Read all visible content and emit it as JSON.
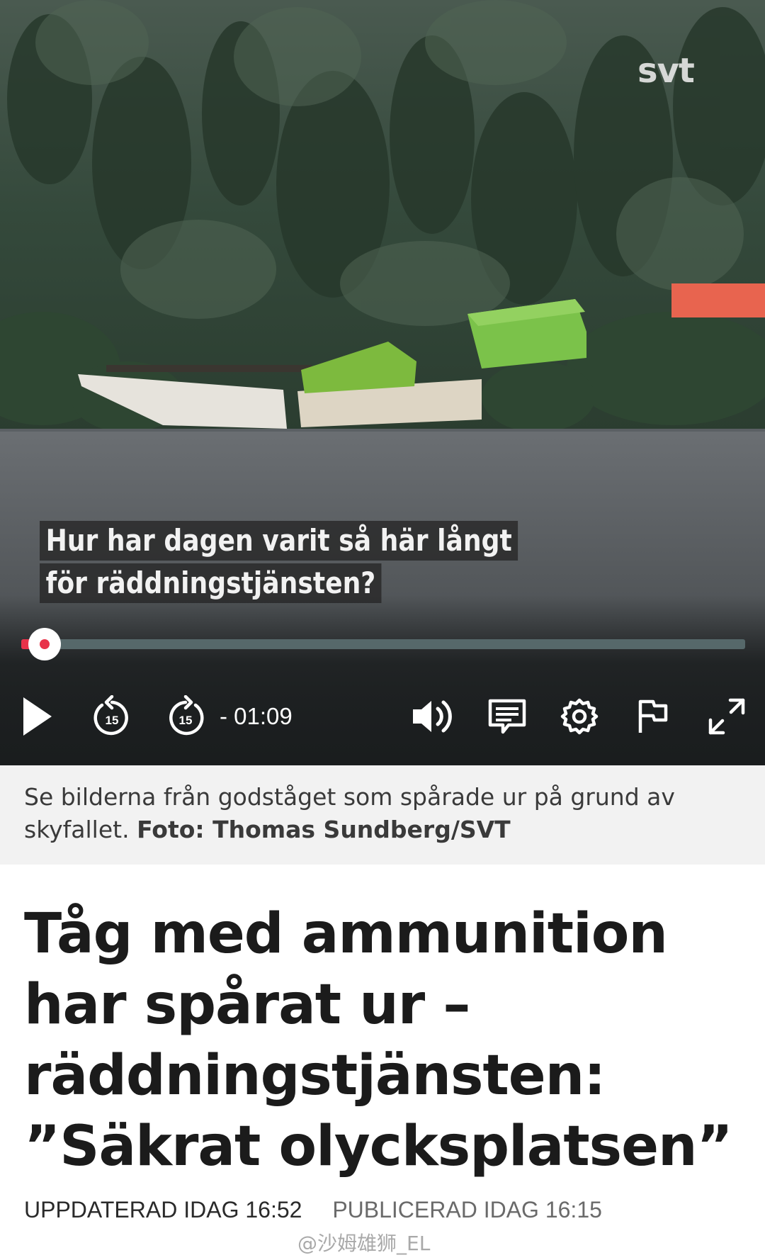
{
  "video": {
    "brand_logo": "svt",
    "subtitle_lines": [
      "Hur har dagen varit så här långt",
      "för räddningstjänsten?"
    ],
    "progress_fraction": 0.01,
    "time_remaining": "- 01:09",
    "skip_back_seconds": "15",
    "skip_forward_seconds": "15",
    "accent_color": "#e8334a",
    "controls": {
      "play": "play-icon",
      "rewind": "rewind-15-icon",
      "forward": "forward-15-icon",
      "volume": "volume-icon",
      "subtitles": "subtitles-icon",
      "settings": "gear-icon",
      "report": "flag-icon",
      "fullscreen": "fullscreen-icon"
    }
  },
  "caption": {
    "text": "Se bilderna från godståget som spårade ur på grund av skyfallet.",
    "credit": "Foto: Thomas Sundberg/SVT"
  },
  "article": {
    "headline": "Tåg med ammunition har spårat ur – räddningstjänsten: ”Säkrat olycksplatsen”",
    "updated": "UPPDATERAD IDAG 16:52",
    "published": "PUBLICERAD IDAG 16:15"
  },
  "watermark": "@沙姆雄狮_EL"
}
